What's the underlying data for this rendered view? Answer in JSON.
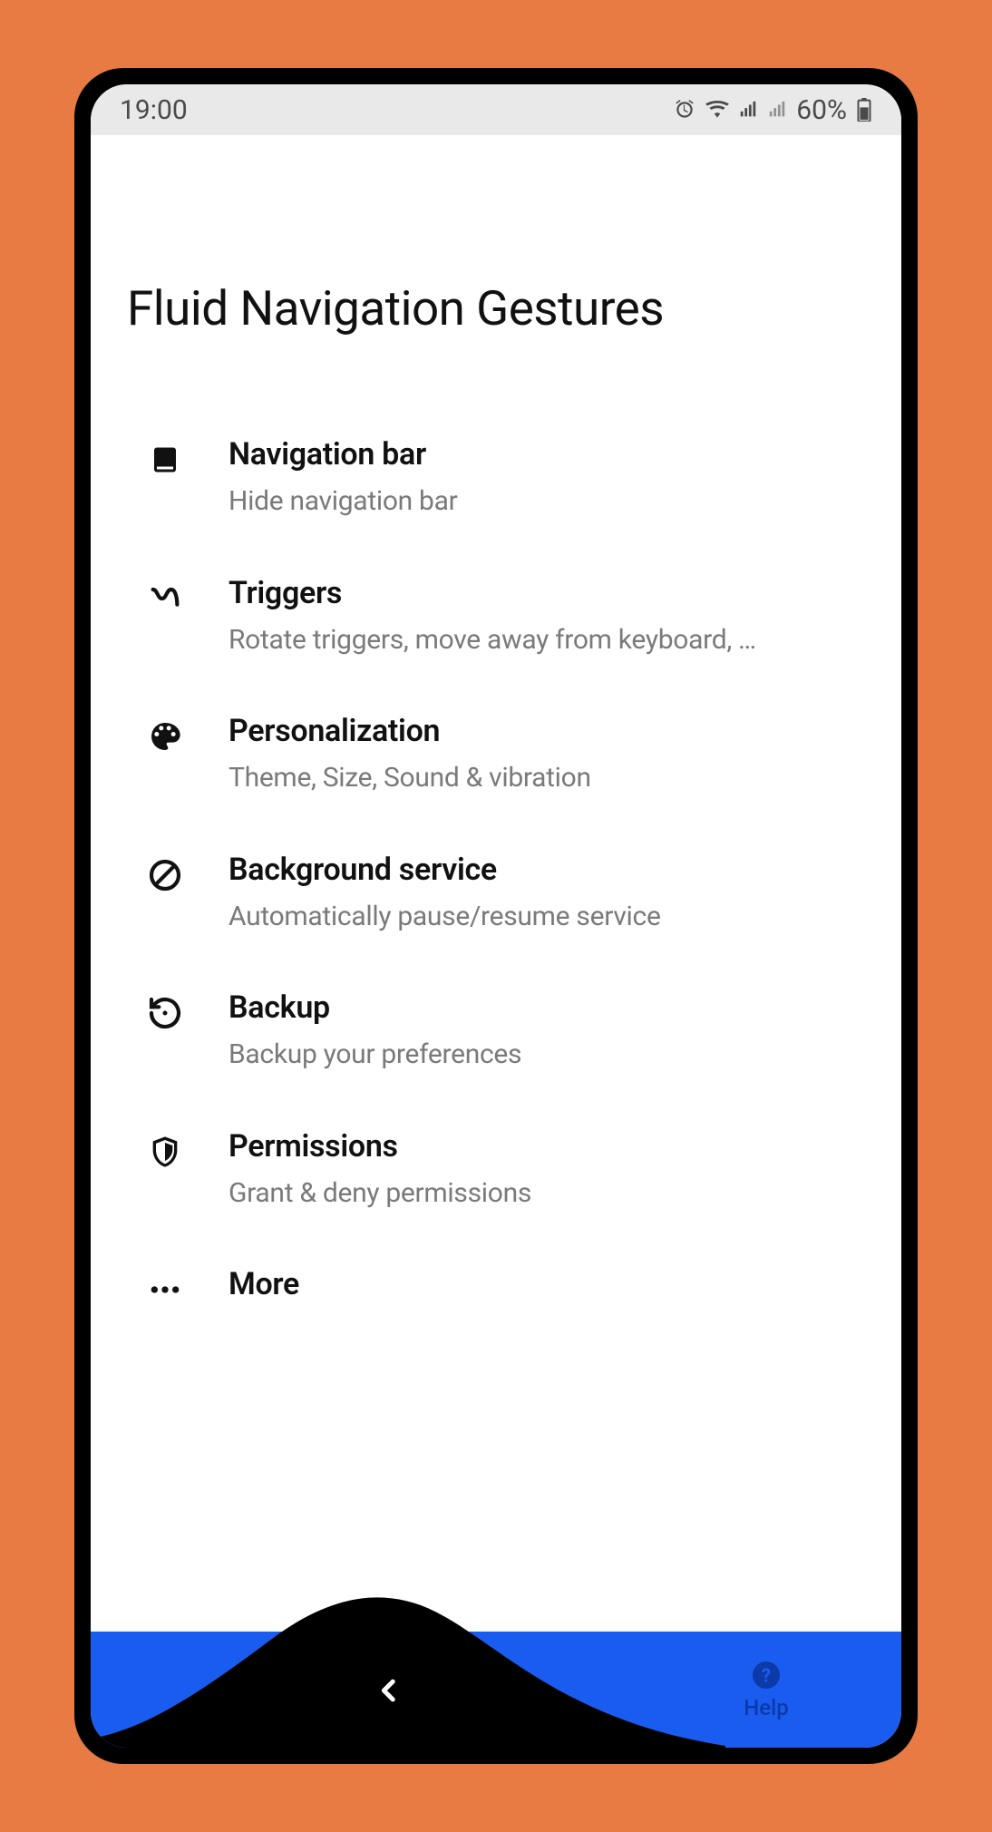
{
  "status": {
    "time": "19:00",
    "battery": "60%"
  },
  "app": {
    "title": "Fluid Navigation Gestures"
  },
  "menu": [
    {
      "title": "Navigation bar",
      "subtitle": "Hide navigation bar"
    },
    {
      "title": "Triggers",
      "subtitle": "Rotate triggers, move away from keyboard, …"
    },
    {
      "title": "Personalization",
      "subtitle": "Theme, Size, Sound & vibration"
    },
    {
      "title": "Background service",
      "subtitle": "Automatically pause/resume service"
    },
    {
      "title": "Backup",
      "subtitle": "Backup your preferences"
    },
    {
      "title": "Permissions",
      "subtitle": "Grant & deny permissions"
    },
    {
      "title": "More",
      "subtitle": ""
    }
  ],
  "nav": {
    "help": "Help"
  }
}
